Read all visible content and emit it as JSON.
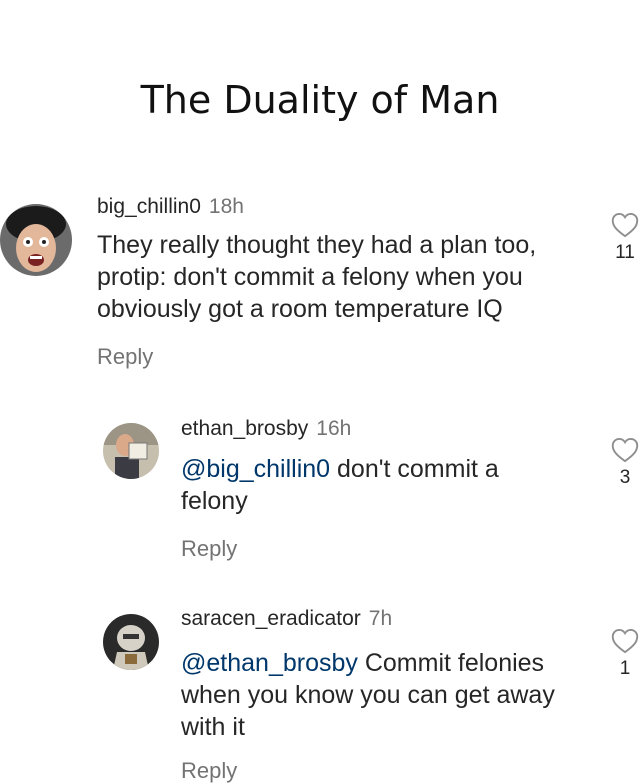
{
  "title": "The Duality of Man",
  "comments": [
    {
      "username": "big_chillin0",
      "time": "18h",
      "mention": "",
      "text": "They really thought they had a plan too, protip: don't commit a felony when you obviously got a room temperature IQ",
      "reply_label": "Reply",
      "likes": "11",
      "avatar_icon": "profile-photo"
    },
    {
      "username": "ethan_brosby",
      "time": "16h",
      "mention": "@big_chillin0",
      "text": " don't commit a felony",
      "reply_label": "Reply",
      "likes": "3",
      "avatar_icon": "profile-photo"
    },
    {
      "username": "saracen_eradicator",
      "time": "7h",
      "mention": "@ethan_brosby",
      "text": " Commit felonies when you know you can get away with it",
      "reply_label": "Reply",
      "likes": "1",
      "avatar_icon": "profile-photo"
    }
  ],
  "colors": {
    "text": "#262626",
    "secondary": "#737373",
    "mention": "#00376b",
    "heart_outline": "#8e8e8e"
  },
  "icons": {
    "like": "heart-outline-icon"
  }
}
